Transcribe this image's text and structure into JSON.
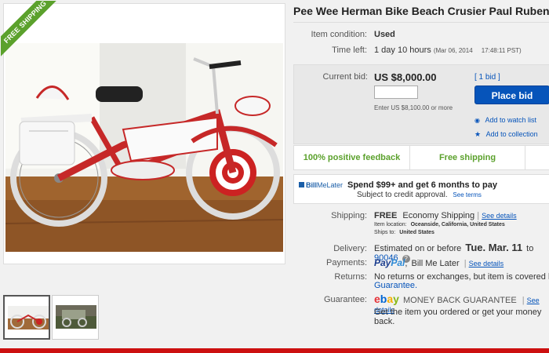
{
  "listing": {
    "title": "Pee Wee Herman Bike Beach Crusier Paul Rubens A",
    "ribbon_label": "FREE SHIPPING"
  },
  "details": {
    "condition_label": "Item condition:",
    "condition_value": "Used",
    "time_left_label": "Time left:",
    "time_left_value": "1 day 10 hours",
    "time_left_date": "(Mar 06, 2014",
    "time_left_time": "17:48:11 PST)"
  },
  "bid": {
    "label": "Current bid:",
    "price": "US $8,000.00",
    "count": "[ 1 bid ]",
    "input_value": "",
    "hint": "Enter US $8,100.00 or more",
    "button": "Place bid",
    "watch": "Add to watch list",
    "collection": "Add to collection"
  },
  "badges": {
    "feedback": "100% positive feedback",
    "shipping": "Free shipping"
  },
  "billmelater": {
    "logo_bill": "Bill",
    "logo_me": "MeLater",
    "offer": "Spend $99+ and get 6 months to pay",
    "subject": "Subject to credit approval.",
    "see_terms": "See terms"
  },
  "shipping": {
    "label": "Shipping:",
    "free": "FREE",
    "method": "Economy Shipping",
    "sep": "|",
    "details_link": "See details",
    "location_label": "Item location:",
    "location": "Oceanside, California, United States",
    "ships_label": "Ships to:",
    "ships_to": "United States"
  },
  "delivery": {
    "label": "Delivery:",
    "prefix": "Estimated on or before",
    "date": "Tue. Mar. 11",
    "to": "to",
    "zip": "90046",
    "info_icon": "?"
  },
  "payments": {
    "label": "Payments:",
    "paypal_pay": "Pay",
    "paypal_pal": "Pal",
    "sep": ",",
    "billmelater": "Bill Me Later",
    "bar": "|",
    "details_link": "See details"
  },
  "returns": {
    "label": "Returns:",
    "text": "No returns or exchanges, but item is covered by the",
    "link_tail": "e",
    "link2": "Guarantee."
  },
  "guarantee": {
    "label": "Guarantee:",
    "e": "e",
    "b": "b",
    "a": "a",
    "y": "y",
    "title": "MONEY BACK GUARANTEE",
    "bar": "|",
    "details_link": "See details",
    "text": "Get the item you ordered or get your money back."
  },
  "colors": {
    "link": "#0654ba",
    "green": "#5ba12c",
    "bottom_bar": "#cc1010"
  }
}
